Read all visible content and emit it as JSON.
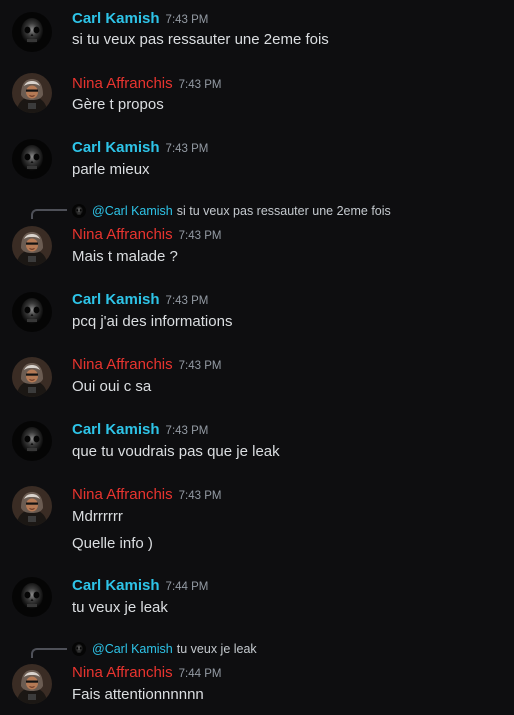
{
  "colors": {
    "background": "#0e0e10",
    "carl_name": "#2ec4e8",
    "nina_name": "#e8342f",
    "message_text": "#dbdee1",
    "timestamp": "#949ba4"
  },
  "users": {
    "carl": {
      "name": "Carl Kamish",
      "avatar_icon": "skull-avatar-icon"
    },
    "nina": {
      "name": "Nina Affranchis",
      "avatar_icon": "hooded-figure-avatar-icon"
    }
  },
  "messages": [
    {
      "author": "Carl Kamish",
      "time": "7:43 PM",
      "text": "si tu veux pas ressauter une 2eme fois"
    },
    {
      "author": "Nina Affranchis",
      "time": "7:43 PM",
      "text": "Gère t propos"
    },
    {
      "author": "Carl Kamish",
      "time": "7:43 PM",
      "text": "parle mieux"
    },
    {
      "author": "Nina Affranchis",
      "time": "7:43 PM",
      "text": "Mais t malade ?",
      "reply_to": {
        "mention": "@Carl Kamish",
        "text": "si tu veux pas ressauter une 2eme fois"
      }
    },
    {
      "author": "Carl Kamish",
      "time": "7:43 PM",
      "text": "pcq j'ai des informations"
    },
    {
      "author": "Nina Affranchis",
      "time": "7:43 PM",
      "text": "Oui oui c sa"
    },
    {
      "author": "Carl Kamish",
      "time": "7:43 PM",
      "text": "que tu voudrais pas que je leak"
    },
    {
      "author": "Nina Affranchis",
      "time": "7:43 PM",
      "text": "Mdrrrrrr",
      "text2": "Quelle info )"
    },
    {
      "author": "Carl Kamish",
      "time": "7:44 PM",
      "text": "tu veux je leak"
    },
    {
      "author": "Nina Affranchis",
      "time": "7:44 PM",
      "text": "Fais attentionnnnnn",
      "reply_to": {
        "mention": "@Carl Kamish",
        "text": "tu veux je leak"
      }
    }
  ]
}
